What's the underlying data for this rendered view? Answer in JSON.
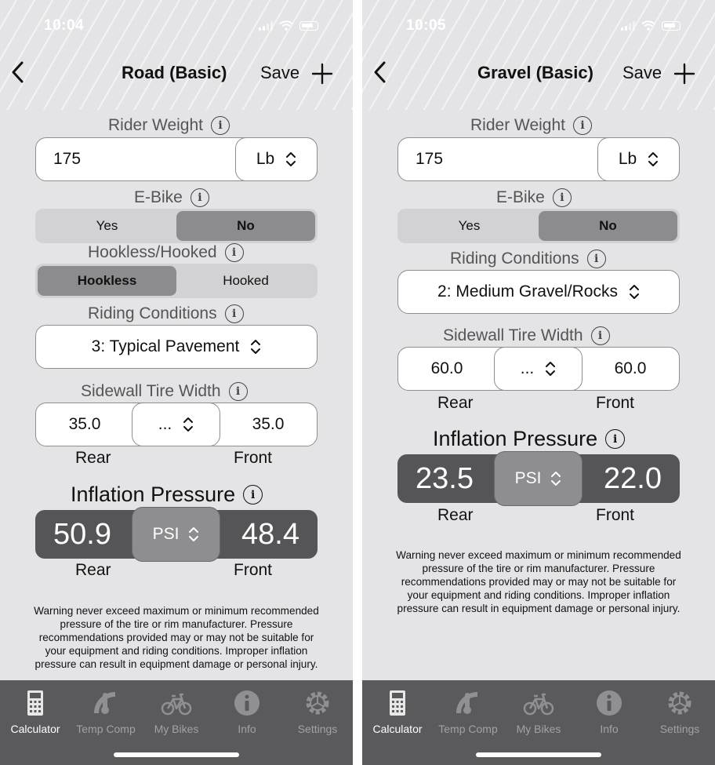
{
  "left": {
    "time": "10:04",
    "nav": {
      "title": "Road (Basic)",
      "save_label": "Save"
    },
    "rider_weight": {
      "label": "Rider Weight",
      "value": "175",
      "unit": "Lb"
    },
    "ebike": {
      "label": "E-Bike",
      "options": [
        "Yes",
        "No"
      ],
      "selected": "No"
    },
    "hookless": {
      "label": "Hookless/Hooked",
      "options": [
        "Hookless",
        "Hooked"
      ],
      "selected": "Hookless"
    },
    "riding_conditions": {
      "label": "Riding Conditions",
      "value": "3: Typical Pavement"
    },
    "tire_width": {
      "label": "Sidewall Tire Width",
      "rear": "35.0",
      "front": "35.0",
      "mode": "...",
      "rear_label": "Rear",
      "front_label": "Front"
    },
    "inflation": {
      "label": "Inflation Pressure",
      "rear": "50.9",
      "front": "48.4",
      "unit": "PSI",
      "rear_label": "Rear",
      "front_label": "Front"
    },
    "warning": "Warning never exceed maximum or minimum recommended pressure of the tire or rim manufacturer. Pressure recommendations provided may or may not be suitable for your equipment and riding conditions. Improper inflation pressure can result in equipment damage or personal injury."
  },
  "right": {
    "time": "10:05",
    "nav": {
      "title": "Gravel (Basic)",
      "save_label": "Save"
    },
    "rider_weight": {
      "label": "Rider Weight",
      "value": "175",
      "unit": "Lb"
    },
    "ebike": {
      "label": "E-Bike",
      "options": [
        "Yes",
        "No"
      ],
      "selected": "No"
    },
    "riding_conditions": {
      "label": "Riding Conditions",
      "value": "2: Medium Gravel/Rocks"
    },
    "tire_width": {
      "label": "Sidewall Tire Width",
      "rear": "60.0",
      "front": "60.0",
      "mode": "...",
      "rear_label": "Rear",
      "front_label": "Front"
    },
    "inflation": {
      "label": "Inflation Pressure",
      "rear": "23.5",
      "front": "22.0",
      "unit": "PSI",
      "rear_label": "Rear",
      "front_label": "Front"
    },
    "warning": "Warning never exceed maximum or minimum recommended pressure of the tire or rim manufacturer. Pressure recommendations provided may or may not be suitable for your equipment and riding conditions. Improper inflation pressure can result in equipment damage or personal injury."
  },
  "tabs": [
    {
      "label": "Calculator",
      "icon": "calculator-icon",
      "active": true
    },
    {
      "label": "Temp Comp",
      "icon": "thermometer-gauge-icon",
      "active": false
    },
    {
      "label": "My Bikes",
      "icon": "bicycle-icon",
      "active": false
    },
    {
      "label": "Info",
      "icon": "info-icon",
      "active": false
    },
    {
      "label": "Settings",
      "icon": "gear-icon",
      "active": false
    }
  ],
  "colors": {
    "background": "#e4e4e6",
    "tabbar": "#5a5a5c",
    "segment_selected": "#8c8c8e",
    "pressure_bar": "#555557"
  }
}
